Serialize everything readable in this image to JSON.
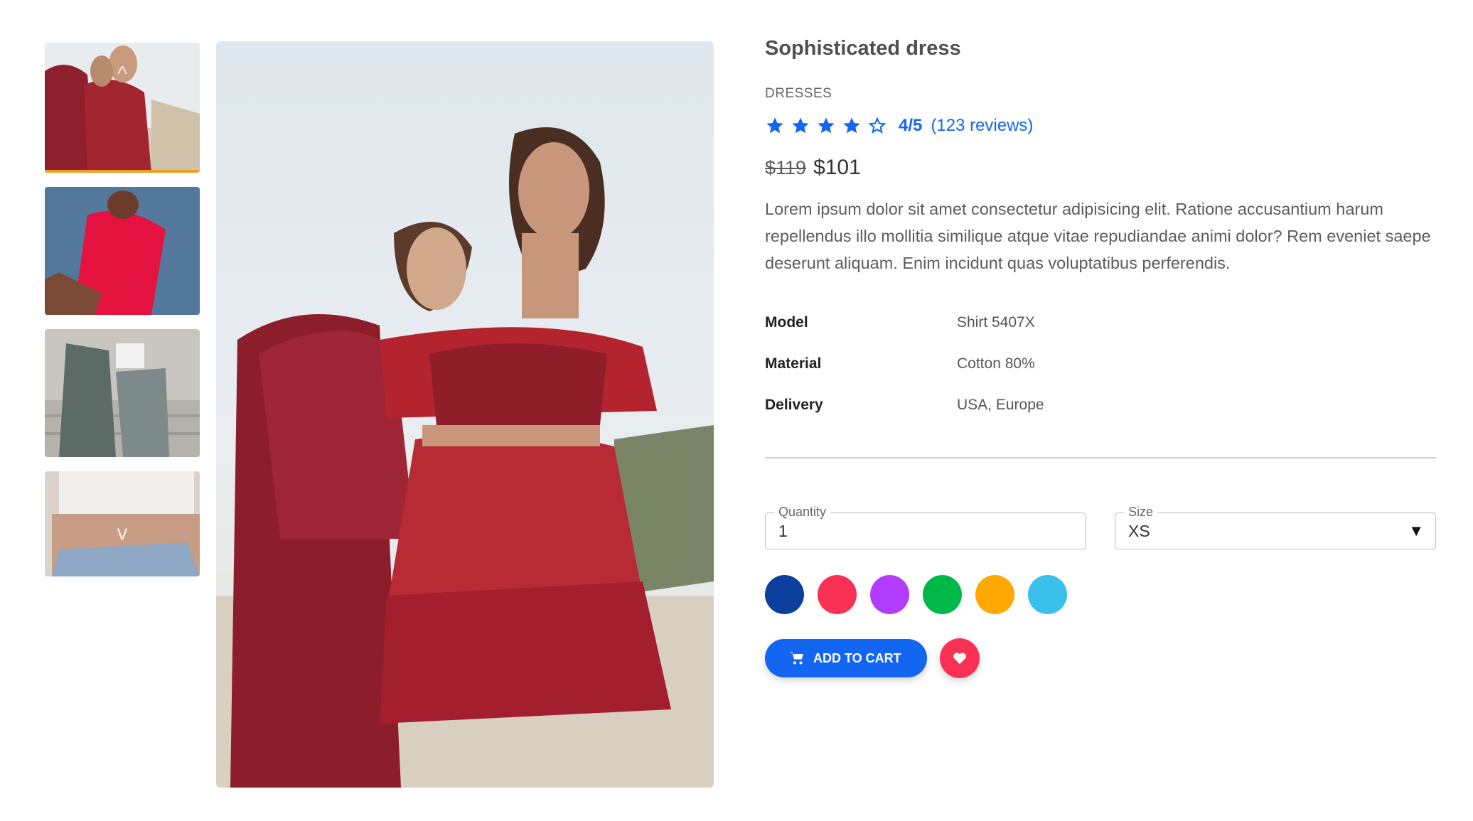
{
  "gallery": {
    "thumbnails": [
      {
        "alt": "Two models in red sequin outfits",
        "active": true
      },
      {
        "alt": "Model in red dress on blue fabric",
        "active": false
      },
      {
        "alt": "Model in grey suit on stairs",
        "active": false
      },
      {
        "alt": "Close-up of jeans and white top",
        "active": false
      }
    ],
    "main_alt": "Two models in red sequin dresses on a beach"
  },
  "product": {
    "title": "Sophisticated dress",
    "category": "DRESSES",
    "rating": {
      "stars": 4,
      "max": 5,
      "score_text": "4/5",
      "reviews_text": "(123 reviews)"
    },
    "old_price": "$119",
    "price": "$101",
    "description": "Lorem ipsum dolor sit amet consectetur adipisicing elit. Ratione accusantium harum repellendus illo mollitia similique atque vitae repudiandae animi dolor? Rem eveniet saepe deserunt aliquam. Enim incidunt quas voluptatibus perferendis.",
    "specs": [
      {
        "key": "Model",
        "value": "Shirt 5407X"
      },
      {
        "key": "Material",
        "value": "Cotton 80%"
      },
      {
        "key": "Delivery",
        "value": "USA, Europe"
      }
    ]
  },
  "form": {
    "quantity_label": "Quantity",
    "quantity_value": "1",
    "size_label": "Size",
    "size_value": "XS"
  },
  "colors": [
    "#0d3f9e",
    "#f93154",
    "#b23cfd",
    "#00b74a",
    "#ffa900",
    "#39c0ed"
  ],
  "actions": {
    "add_to_cart": "ADD TO CART"
  },
  "theme": {
    "primary": "#1266f1",
    "danger": "#f93154",
    "active_thumb": "#f0a020"
  }
}
